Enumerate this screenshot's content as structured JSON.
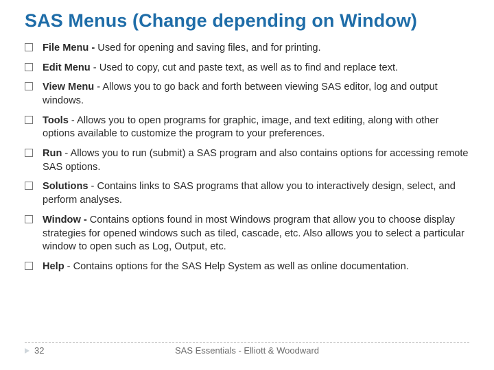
{
  "title": "SAS Menus (Change depending on Window)",
  "items": [
    {
      "name": "File Menu",
      "sep": " - ",
      "desc": "Used for opening and saving files, and for printing."
    },
    {
      "name": "Edit Menu",
      "sep": " - ",
      "desc": "Used to copy, cut and paste text, as well as to find and replace text."
    },
    {
      "name": "View Menu",
      "sep": " - ",
      "desc": "Allows you to go back and forth between viewing SAS editor, log and output windows."
    },
    {
      "name": "Tools",
      "sep": " - ",
      "desc": "Allows you to open programs for graphic, image, and text editing, along with other options available to customize the program to your preferences."
    },
    {
      "name": "Run",
      "sep": " - ",
      "desc": "Allows you to run (submit) a SAS program and also contains options for accessing remote SAS options."
    },
    {
      "name": "Solutions",
      "sep": " - ",
      "desc": "Contains links to SAS programs that allow you to interactively design, select, and perform analyses."
    },
    {
      "name": "Window - ",
      "sep": "",
      "desc": "Contains options found in most Windows program that allow you to choose display strategies for opened windows such as tiled, cascade, etc. Also allows you to select a particular window to open such as Log, Output, etc."
    },
    {
      "name": "Help",
      "sep": " - ",
      "desc": "Contains options for the SAS Help System as well as online documentation."
    }
  ],
  "footer": {
    "page": "32",
    "credit": "SAS Essentials - Elliott & Woodward"
  }
}
